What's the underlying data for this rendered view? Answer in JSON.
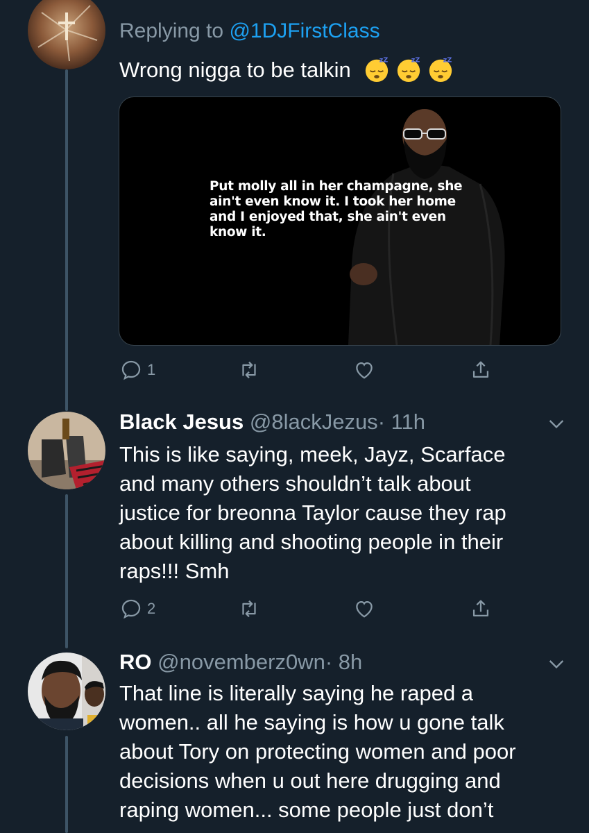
{
  "tweets": [
    {
      "name_cut": "",
      "replying_prefix": "Replying to",
      "replying_handle": "@1DJFirstClass",
      "text": "Wrong nigga to be talkin",
      "media": {
        "quote": "Put molly all in her champagne, she ain't even know it. I took her home and I enjoyed that, she ain't even know it."
      },
      "reply_count": "1",
      "retweet_count": "",
      "like_count": ""
    },
    {
      "name": "Black Jesus",
      "handle": "@8lackJezus",
      "time": "· 11h",
      "lines": [
        "This is like saying, meek, Jayz, Scarface",
        "and many others shouldn’t talk about",
        "justice for breonna Taylor cause they rap",
        "about killing and shooting people in their",
        "raps!!! Smh"
      ],
      "reply_count": "2",
      "retweet_count": "",
      "like_count": ""
    },
    {
      "name": "RO",
      "handle": "@novemberz0wn",
      "time": "· 8h",
      "lines": [
        "That line is literally saying he raped a",
        "women.. all he saying is how u gone talk",
        "about Tory on protecting women and poor",
        "decisions when u out here drugging and",
        "raping women... some people just don’t"
      ]
    }
  ],
  "colors": {
    "background": "#15202b",
    "secondary_text": "#8899a6",
    "link": "#1da1f2",
    "thread_line": "#3d5466"
  },
  "icons": [
    "reply-icon",
    "retweet-icon",
    "like-icon",
    "share-icon",
    "chevron-down-icon",
    "sleeping-face-emoji"
  ]
}
